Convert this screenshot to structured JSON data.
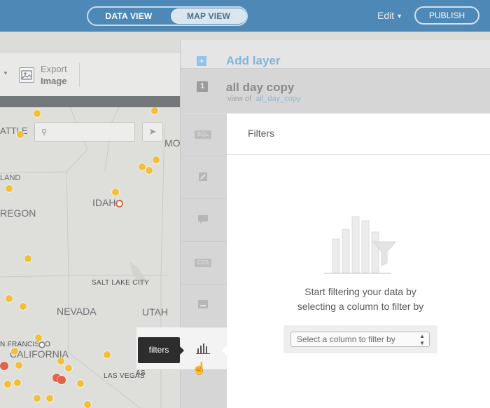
{
  "topbar": {
    "data_view_label": "DATA VIEW",
    "map_view_label": "MAP VIEW",
    "edit_label": "Edit",
    "publish_label": "PUBLISH"
  },
  "map_toolbar": {
    "export_line1": "Export",
    "export_line2": "Image"
  },
  "map": {
    "labels": {
      "seattle": "ATTLE",
      "portland": "LAND",
      "oregon": "REGON",
      "idaho": "IDAHO",
      "montana": "MO",
      "salt_lake": "SALT LAKE CITY",
      "nevada": "NEVADA",
      "utah": "UTAH",
      "san_francisco": "N FRANCISCO",
      "california": "CALIFORNIA",
      "las_vegas": "LAS VEGAS",
      "as": "AS"
    }
  },
  "panel": {
    "add_layer_label": "Add layer",
    "layer_number": "1",
    "layer_name": "all day copy",
    "layer_view_of": "view of",
    "layer_source": "all_day_copy",
    "tools": [
      "SQL",
      "wizard",
      "infowindow",
      "CSS",
      "legend",
      "filters"
    ],
    "tooltip": "filters",
    "content_title": "Filters",
    "empty_line1": "Start filtering your data by",
    "empty_line2": "selecting a column to filter by",
    "select_placeholder": "Select a column to filter by"
  },
  "colors": {
    "topbar": "#4e88b6",
    "dot_yellow": "#f2c038",
    "dot_red": "#e0634a",
    "accent_link": "#7fb6dc"
  }
}
